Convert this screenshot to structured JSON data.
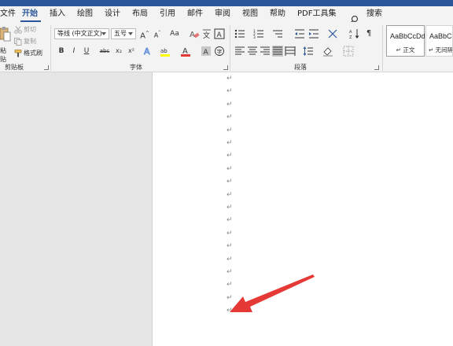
{
  "tabs": [
    {
      "label": "文件",
      "active": false
    },
    {
      "label": "开始",
      "active": true
    },
    {
      "label": "插入",
      "active": false
    },
    {
      "label": "绘图",
      "active": false
    },
    {
      "label": "设计",
      "active": false
    },
    {
      "label": "布局",
      "active": false
    },
    {
      "label": "引用",
      "active": false
    },
    {
      "label": "邮件",
      "active": false
    },
    {
      "label": "审阅",
      "active": false
    },
    {
      "label": "视图",
      "active": false
    },
    {
      "label": "帮助",
      "active": false
    },
    {
      "label": "PDF工具集",
      "active": false
    }
  ],
  "search_label": "搜索",
  "clipboard": {
    "paste": "粘贴",
    "cut": "剪切",
    "copy": "复制",
    "format_painter": "格式刷",
    "group_label": "剪贴板"
  },
  "font": {
    "font_name": "等线 (中文正文)",
    "font_size": "五号",
    "grow": "A",
    "shrink": "A",
    "change_case": "Aa",
    "bold": "B",
    "italic": "I",
    "underline": "U",
    "strikethrough": "abc",
    "subscript": "x₂",
    "superscript": "x²",
    "group_label": "字体"
  },
  "paragraph": {
    "group_label": "段落"
  },
  "styles": {
    "items": [
      {
        "sample": "AaBbCcDd",
        "name": "↵ 正文"
      },
      {
        "sample": "AaBbCcDd",
        "name": "↵ 无间隔"
      }
    ]
  },
  "document": {
    "paragraph_mark": "↵",
    "paragraph_count": 19
  },
  "colors": {
    "accent": "#2b579a",
    "arrow": "#e53935",
    "font_color": "#e53935",
    "highlight": "#ffff00"
  }
}
